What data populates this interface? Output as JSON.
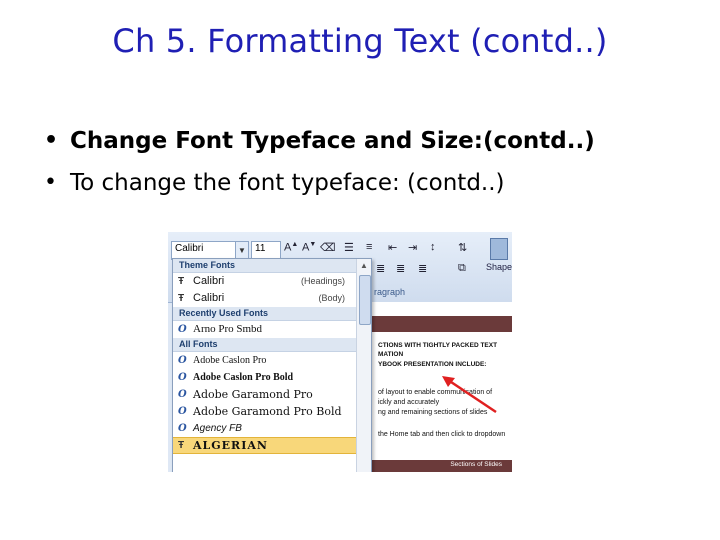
{
  "slide": {
    "title": "Ch 5. Formatting Text  (contd..)",
    "bullets": [
      "Change Font Typeface and Size:(contd..)",
      "To change the font typeface: (contd..)"
    ],
    "bullet_glyph": "•"
  },
  "screenshot": {
    "ribbon": {
      "font_value": "Calibri",
      "size_value": "11",
      "paragraph_label": "ragraph",
      "shapes_label": "Shape"
    },
    "dropdown": {
      "sections": {
        "theme": "Theme Fonts",
        "recent": "Recently Used Fonts",
        "all": "All Fonts"
      },
      "theme_fonts": [
        {
          "name": "Calibri",
          "role": "(Headings)"
        },
        {
          "name": "Calibri",
          "role": "(Body)"
        }
      ],
      "recent_fonts": [
        "Arno Pro Smbd"
      ],
      "all_fonts": [
        "Adobe Caslon Pro",
        "Adobe Caslon Pro Bold",
        "Adobe Garamond Pro",
        "Adobe Garamond Pro Bold",
        "Agency FB",
        "ALGERIAN"
      ],
      "highlighted": "ALGERIAN"
    },
    "document": {
      "lines": [
        "CTIONS WITH TIGHTLY PACKED TEXT",
        "MATION",
        "YBOOK PRESENTATION INCLUDE:",
        "of layout to enable communication of",
        "ickly and accurately",
        "ng and remaining sections of slides",
        "the Home tab and then click to dropdown"
      ],
      "footer": "Sections of Slides"
    },
    "arrow_color": "#e02020"
  }
}
